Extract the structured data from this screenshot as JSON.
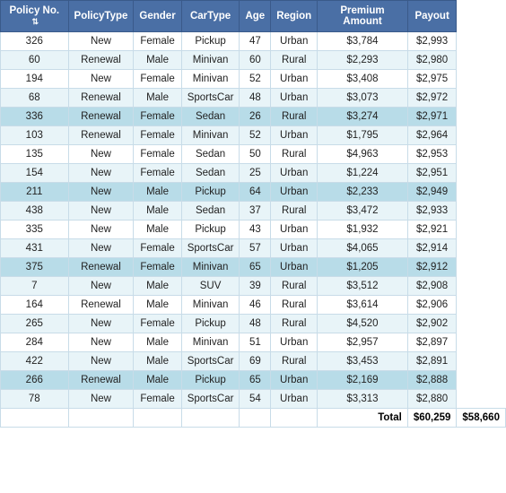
{
  "table": {
    "columns": [
      {
        "label": "Policy No.",
        "sortable": true
      },
      {
        "label": "PolicyType",
        "sortable": false
      },
      {
        "label": "Gender",
        "sortable": false
      },
      {
        "label": "CarType",
        "sortable": false
      },
      {
        "label": "Age",
        "sortable": false
      },
      {
        "label": "Region",
        "sortable": false
      },
      {
        "label": "Premium Amount",
        "sortable": false
      },
      {
        "label": "Payout",
        "sortable": false
      }
    ],
    "rows": [
      {
        "policy": "326",
        "policyType": "New",
        "gender": "Female",
        "carType": "Pickup",
        "age": "47",
        "region": "Urban",
        "premium": "$3,784",
        "payout": "$2,993",
        "highlight": false
      },
      {
        "policy": "60",
        "policyType": "Renewal",
        "gender": "Male",
        "carType": "Minivan",
        "age": "60",
        "region": "Rural",
        "premium": "$2,293",
        "payout": "$2,980",
        "highlight": false
      },
      {
        "policy": "194",
        "policyType": "New",
        "gender": "Female",
        "carType": "Minivan",
        "age": "52",
        "region": "Urban",
        "premium": "$3,408",
        "payout": "$2,975",
        "highlight": false
      },
      {
        "policy": "68",
        "policyType": "Renewal",
        "gender": "Male",
        "carType": "SportsCar",
        "age": "48",
        "region": "Urban",
        "premium": "$3,073",
        "payout": "$2,972",
        "highlight": false
      },
      {
        "policy": "336",
        "policyType": "Renewal",
        "gender": "Female",
        "carType": "Sedan",
        "age": "26",
        "region": "Rural",
        "premium": "$3,274",
        "payout": "$2,971",
        "highlight": true
      },
      {
        "policy": "103",
        "policyType": "Renewal",
        "gender": "Female",
        "carType": "Minivan",
        "age": "52",
        "region": "Urban",
        "premium": "$1,795",
        "payout": "$2,964",
        "highlight": false
      },
      {
        "policy": "135",
        "policyType": "New",
        "gender": "Female",
        "carType": "Sedan",
        "age": "50",
        "region": "Rural",
        "premium": "$4,963",
        "payout": "$2,953",
        "highlight": false
      },
      {
        "policy": "154",
        "policyType": "New",
        "gender": "Female",
        "carType": "Sedan",
        "age": "25",
        "region": "Urban",
        "premium": "$1,224",
        "payout": "$2,951",
        "highlight": false
      },
      {
        "policy": "211",
        "policyType": "New",
        "gender": "Male",
        "carType": "Pickup",
        "age": "64",
        "region": "Urban",
        "premium": "$2,233",
        "payout": "$2,949",
        "highlight": true
      },
      {
        "policy": "438",
        "policyType": "New",
        "gender": "Male",
        "carType": "Sedan",
        "age": "37",
        "region": "Rural",
        "premium": "$3,472",
        "payout": "$2,933",
        "highlight": false
      },
      {
        "policy": "335",
        "policyType": "New",
        "gender": "Male",
        "carType": "Pickup",
        "age": "43",
        "region": "Urban",
        "premium": "$1,932",
        "payout": "$2,921",
        "highlight": false
      },
      {
        "policy": "431",
        "policyType": "New",
        "gender": "Female",
        "carType": "SportsCar",
        "age": "57",
        "region": "Urban",
        "premium": "$4,065",
        "payout": "$2,914",
        "highlight": false
      },
      {
        "policy": "375",
        "policyType": "Renewal",
        "gender": "Female",
        "carType": "Minivan",
        "age": "65",
        "region": "Urban",
        "premium": "$1,205",
        "payout": "$2,912",
        "highlight": true
      },
      {
        "policy": "7",
        "policyType": "New",
        "gender": "Male",
        "carType": "SUV",
        "age": "39",
        "region": "Rural",
        "premium": "$3,512",
        "payout": "$2,908",
        "highlight": false
      },
      {
        "policy": "164",
        "policyType": "Renewal",
        "gender": "Male",
        "carType": "Minivan",
        "age": "46",
        "region": "Rural",
        "premium": "$3,614",
        "payout": "$2,906",
        "highlight": false
      },
      {
        "policy": "265",
        "policyType": "New",
        "gender": "Female",
        "carType": "Pickup",
        "age": "48",
        "region": "Rural",
        "premium": "$4,520",
        "payout": "$2,902",
        "highlight": false
      },
      {
        "policy": "284",
        "policyType": "New",
        "gender": "Male",
        "carType": "Minivan",
        "age": "51",
        "region": "Urban",
        "premium": "$2,957",
        "payout": "$2,897",
        "highlight": false
      },
      {
        "policy": "422",
        "policyType": "New",
        "gender": "Male",
        "carType": "SportsCar",
        "age": "69",
        "region": "Rural",
        "premium": "$3,453",
        "payout": "$2,891",
        "highlight": false
      },
      {
        "policy": "266",
        "policyType": "Renewal",
        "gender": "Male",
        "carType": "Pickup",
        "age": "65",
        "region": "Urban",
        "premium": "$2,169",
        "payout": "$2,888",
        "highlight": true
      },
      {
        "policy": "78",
        "policyType": "New",
        "gender": "Female",
        "carType": "SportsCar",
        "age": "54",
        "region": "Urban",
        "premium": "$3,313",
        "payout": "$2,880",
        "highlight": false
      }
    ],
    "footer": {
      "label": "Total",
      "premium": "$60,259",
      "payout": "$58,660"
    }
  }
}
